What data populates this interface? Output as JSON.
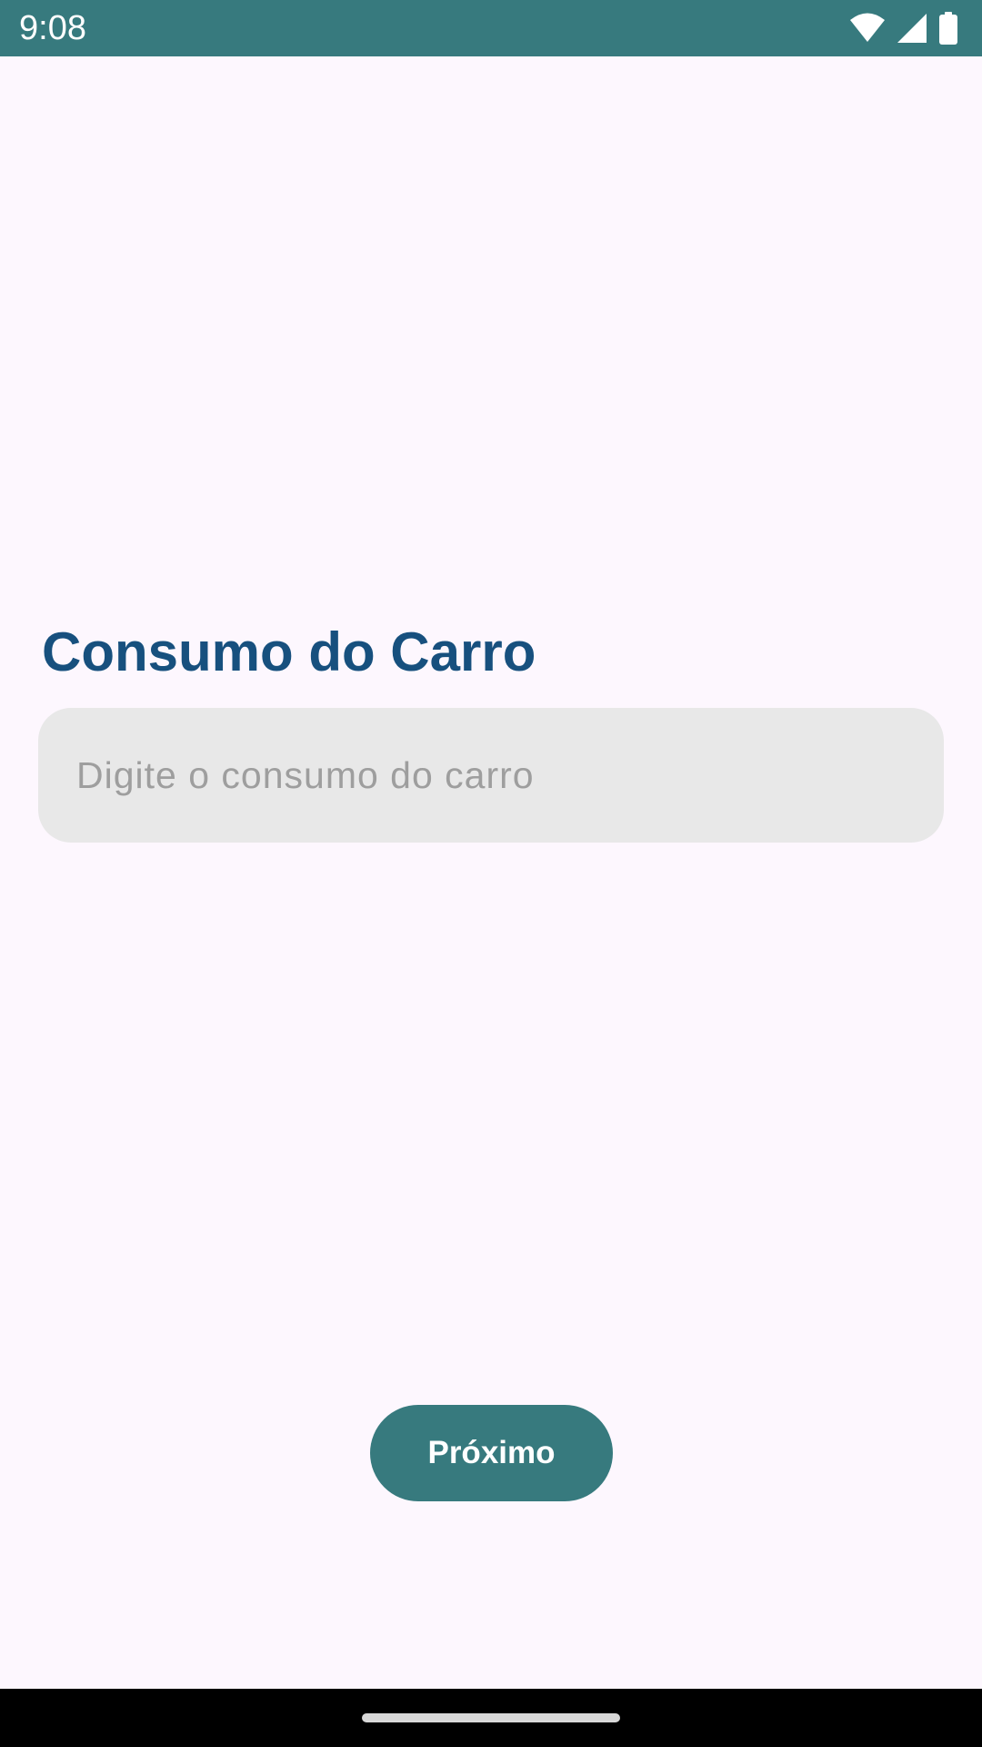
{
  "status_bar": {
    "time": "9:08",
    "background_color": "#377A7E",
    "icons": [
      "wifi-icon",
      "cell-signal-icon",
      "battery-icon"
    ]
  },
  "screen": {
    "title": "Consumo do Carro",
    "title_color": "#17507E",
    "background_color": "#FDF7FE"
  },
  "consumption_input": {
    "value": "",
    "placeholder": "Digite o consumo do carro",
    "background_color": "#E8E8E8"
  },
  "next_button": {
    "label": "Próximo",
    "background_color": "#377A7E"
  },
  "navigation_bar": {
    "background_color": "#000000",
    "handle": "home-gesture-handle"
  }
}
